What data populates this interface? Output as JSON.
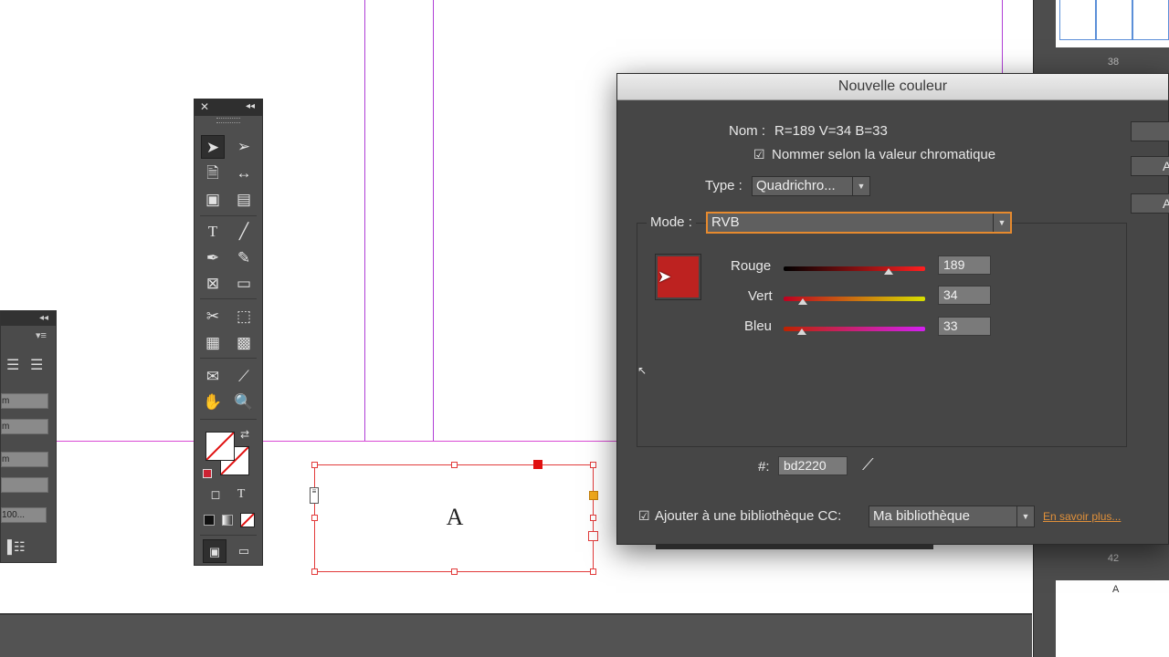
{
  "colors": {
    "swatch": "#bd2220",
    "link": "#e0903a",
    "accent_border": "#e68a2e"
  },
  "canvas": {
    "frame_letter": "A"
  },
  "pages_panel": {
    "page_numbers": [
      "38",
      "42"
    ],
    "page_letter": "A"
  },
  "left_panel": {
    "fields": [
      "m",
      "m",
      "m",
      "",
      "100..."
    ]
  },
  "tools_panel": {
    "tools": [
      "selection-tool",
      "direct-selection-tool",
      "page-tool",
      "gap-tool",
      "content-collector-tool",
      "content-placer-tool",
      "type-tool",
      "line-tool",
      "pen-tool",
      "pencil-tool",
      "rectangle-frame-tool",
      "rectangle-tool",
      "scissors-tool",
      "free-transform-tool",
      "gradient-swatch-tool",
      "gradient-feather-tool",
      "note-tool",
      "eyedropper-tool",
      "hand-tool",
      "zoom-tool"
    ],
    "format_type_label": "T"
  },
  "dialog": {
    "title": "Nouvelle couleur",
    "name_label": "Nom :",
    "name_value": "R=189 V=34 B=33",
    "name_by_value_label": "Nommer selon la valeur chromatique",
    "name_by_value_checked": true,
    "type_label": "Type :",
    "type_value": "Quadrichro...",
    "mode_label": "Mode :",
    "mode_value": "RVB",
    "sliders": [
      {
        "label": "Rouge",
        "value": "189",
        "fraction": 0.741
      },
      {
        "label": "Vert",
        "value": "34",
        "fraction": 0.133
      },
      {
        "label": "Bleu",
        "value": "33",
        "fraction": 0.129
      }
    ],
    "hex_label": "#:",
    "hex_value": "bd2220",
    "add_cc_label": "Ajouter à une bibliothèque CC:",
    "add_cc_checked": true,
    "library_value": "Ma bibliothèque",
    "learn_more": "En savoir plus...",
    "side_buttons": [
      "",
      "A",
      "A"
    ]
  }
}
